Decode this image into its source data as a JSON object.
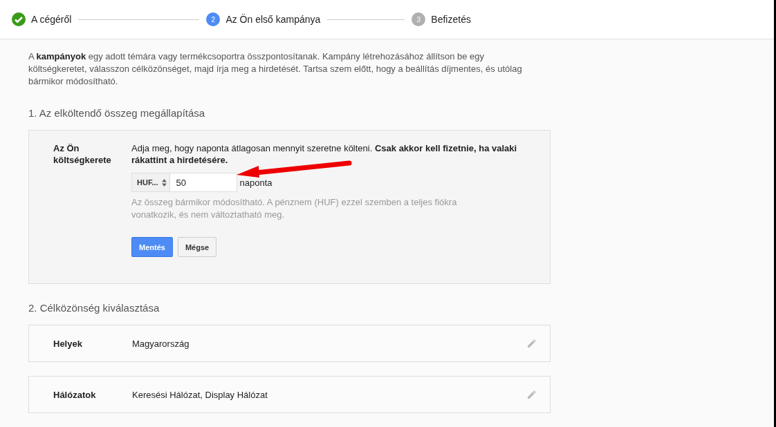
{
  "steps": [
    {
      "label": "A cégéről",
      "completed": true,
      "selected": false
    },
    {
      "marker": "2",
      "label": "Az Ön első kampánya",
      "completed": false,
      "selected": true
    },
    {
      "marker": "3",
      "label": "Befizetés",
      "completed": false,
      "selected": false
    }
  ],
  "intro": "A **kampányok** egy adott témára vagy termékcsoportra összpontosítanak. Kampány létrehozásához állítson be egy költségkeretet, válasszon célközönséget, majd írja meg a hirdetését. Tartsa szem előtt, hogy a beállítás díjmentes, és utólag bármikor módosítható.",
  "section_1": {
    "heading": "1. Az elköltendő összeg megállapítása",
    "budget": {
      "label": "Az Ön költségkerete",
      "description": "Adja meg, hogy naponta átlagosan mennyit szeretne költeni. **Csak akkor kell fizetnie, ha valaki rákattint a hirdetésére.**",
      "currency": "HUF...",
      "amount": "50",
      "unit": "naponta",
      "hint": "Az összeg bármikor módosítható. A pénznem (HUF) ezzel szemben a teljes fiókra vonatkozik, és nem változtatható meg.",
      "buttons": [
        {
          "label": "Mentés",
          "kind": "primary"
        },
        {
          "label": "Mégse",
          "kind": "secondary"
        }
      ]
    }
  },
  "section_2": {
    "heading": "2. Célközönség kiválasztása",
    "rows": [
      {
        "label": "Helyek",
        "value": "Magyarország"
      },
      {
        "label": "Hálózatok",
        "value": "Keresési Hálózat, Display Hálózat"
      }
    ]
  }
}
